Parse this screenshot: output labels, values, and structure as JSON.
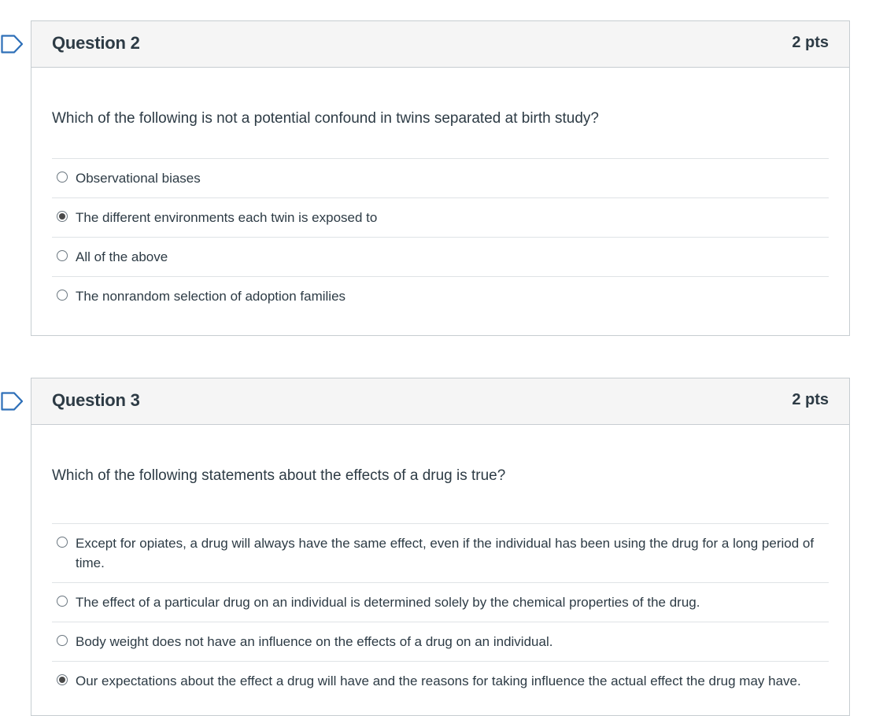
{
  "questions": [
    {
      "title": "Question 2",
      "points": "2 pts",
      "text": "Which of the following is not a potential confound in twins separated at birth study?",
      "answers": [
        {
          "label": "Observational biases",
          "selected": false
        },
        {
          "label": "The different environments each twin is exposed to",
          "selected": true
        },
        {
          "label": "All of the above",
          "selected": false
        },
        {
          "label": "The nonrandom selection of adoption families",
          "selected": false
        }
      ]
    },
    {
      "title": "Question 3",
      "points": "2 pts",
      "text": "Which of the following statements about the effects of a drug is true?",
      "answers": [
        {
          "label": "Except for opiates, a drug will always have the same effect, even if the individual has been using the drug for a long period of time.",
          "selected": false
        },
        {
          "label": "The effect of a particular drug on an individual is determined solely by the chemical properties of the drug.",
          "selected": false
        },
        {
          "label": "Body weight does not have an influence on the effects of a drug on an individual.",
          "selected": false
        },
        {
          "label": "Our expectations about the effect a drug will have and the reasons for taking influence the actual effect the drug may have.",
          "selected": true
        }
      ]
    }
  ],
  "colors": {
    "flag": "#2d6fb8",
    "border": "#c7cdd1",
    "header_bg": "#f5f5f5",
    "text": "#2d3b45"
  }
}
